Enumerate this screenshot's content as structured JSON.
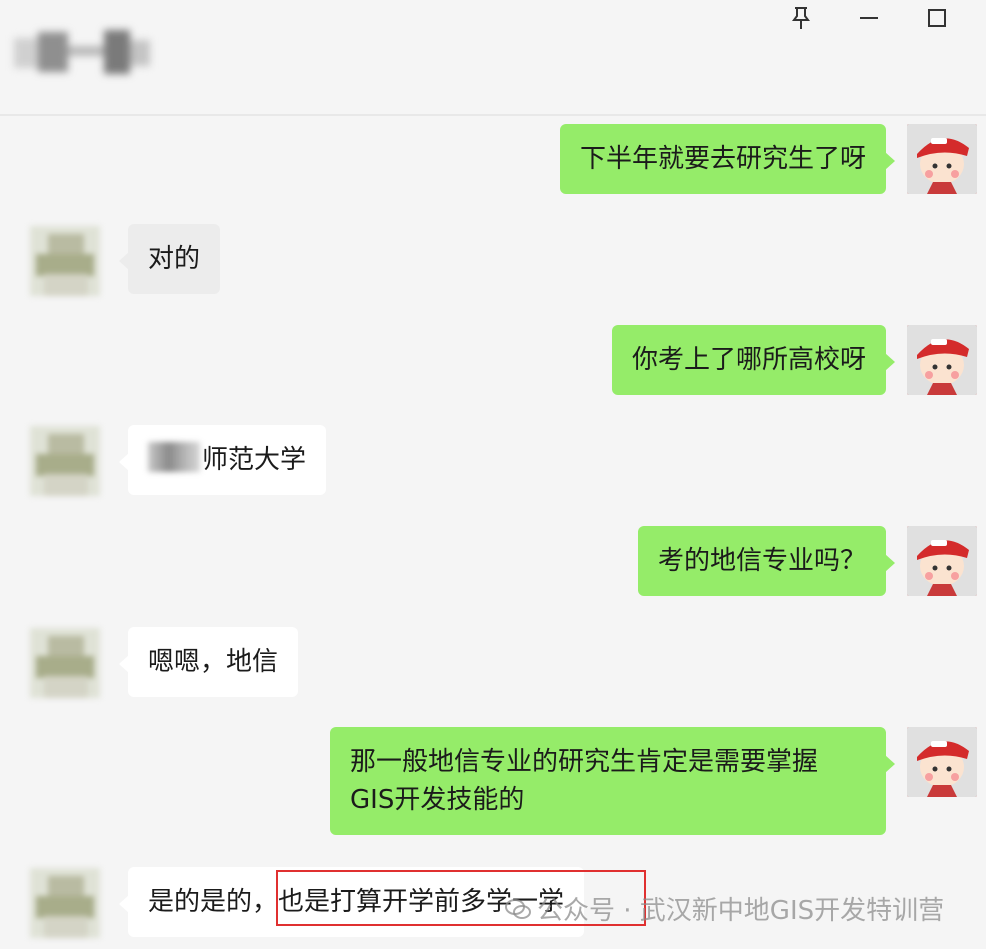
{
  "window": {
    "title_blurred": "",
    "controls": [
      "pin-icon",
      "minimize-icon",
      "maximize-icon"
    ]
  },
  "messages": [
    {
      "side": "self",
      "text": "下半年就要去研究生了呀"
    },
    {
      "side": "other",
      "text": "对的"
    },
    {
      "side": "self",
      "text": "你考上了哪所高校呀"
    },
    {
      "side": "other",
      "text_visible": "师范大学"
    },
    {
      "side": "self",
      "text": "考的地信专业吗？"
    },
    {
      "side": "other",
      "text": "嗯嗯，地信"
    },
    {
      "side": "self",
      "text_line1": "那一般地信专业的研究生肯定是需要掌握",
      "text_line2": "GIS开发技能的"
    },
    {
      "side": "other",
      "text_part1": "是的是的，",
      "text_part2": "也是打算开学前多学一学"
    }
  ],
  "watermark": {
    "text": "公众号 · 武汉新中地GIS开发特训营"
  },
  "colors": {
    "self_bubble": "#95ec69",
    "other_bubble": "#ffffff",
    "background": "#f5f5f5",
    "highlight": "#e03030"
  }
}
